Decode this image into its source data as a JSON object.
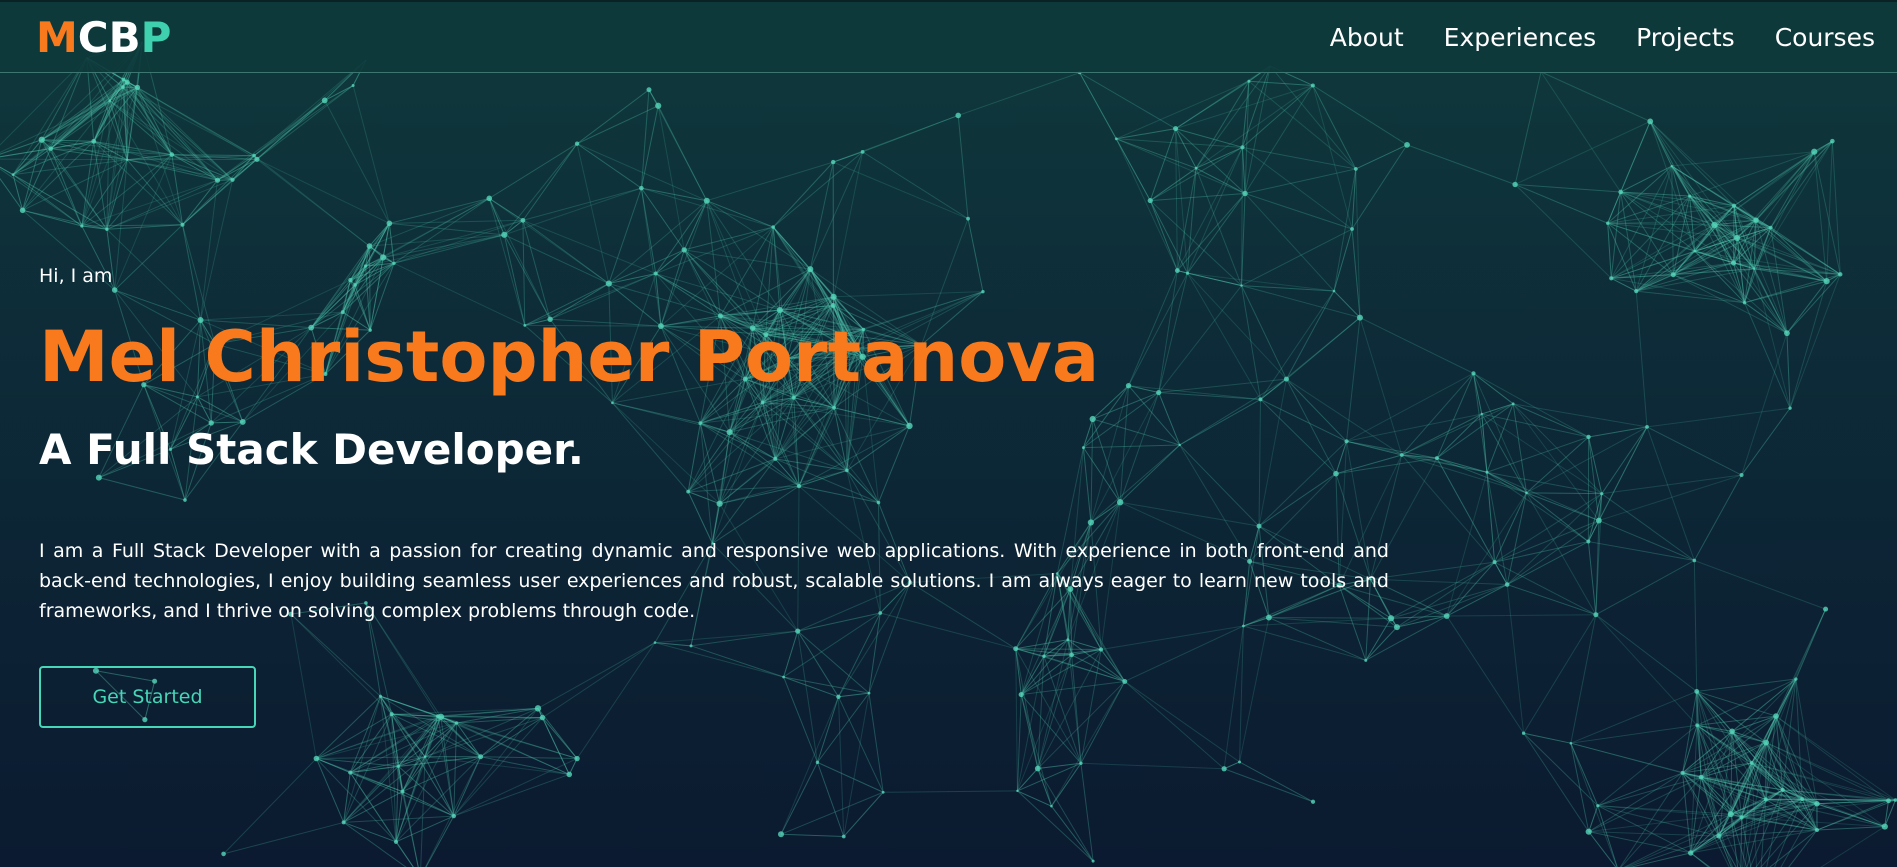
{
  "logo": {
    "part1": "M",
    "part2": "CB",
    "part3": "P",
    "colors": {
      "part1": "#f97a1d",
      "part2": "#ffffff",
      "part3": "#3fd0b0"
    }
  },
  "nav": {
    "items": [
      {
        "label": "About"
      },
      {
        "label": "Experiences"
      },
      {
        "label": "Projects"
      },
      {
        "label": "Courses"
      }
    ]
  },
  "hero": {
    "greeting": "Hi, I am",
    "name": "Mel Christopher Portanova",
    "role": "A Full Stack Developer.",
    "bio": "I am a Full Stack Developer with a passion for creating dynamic and responsive web applications. With experience in both front-end and back-end technologies, I enjoy building seamless user experiences and robust, scalable solutions. I am always eager to learn new tools and frameworks, and I thrive on solving complex problems through code.",
    "cta_label": "Get Started"
  },
  "theme": {
    "accent": "#f97a1d",
    "teal": "#46d6b8",
    "background_top": "#0f3a3c",
    "background_bottom": "#0b1a30"
  }
}
